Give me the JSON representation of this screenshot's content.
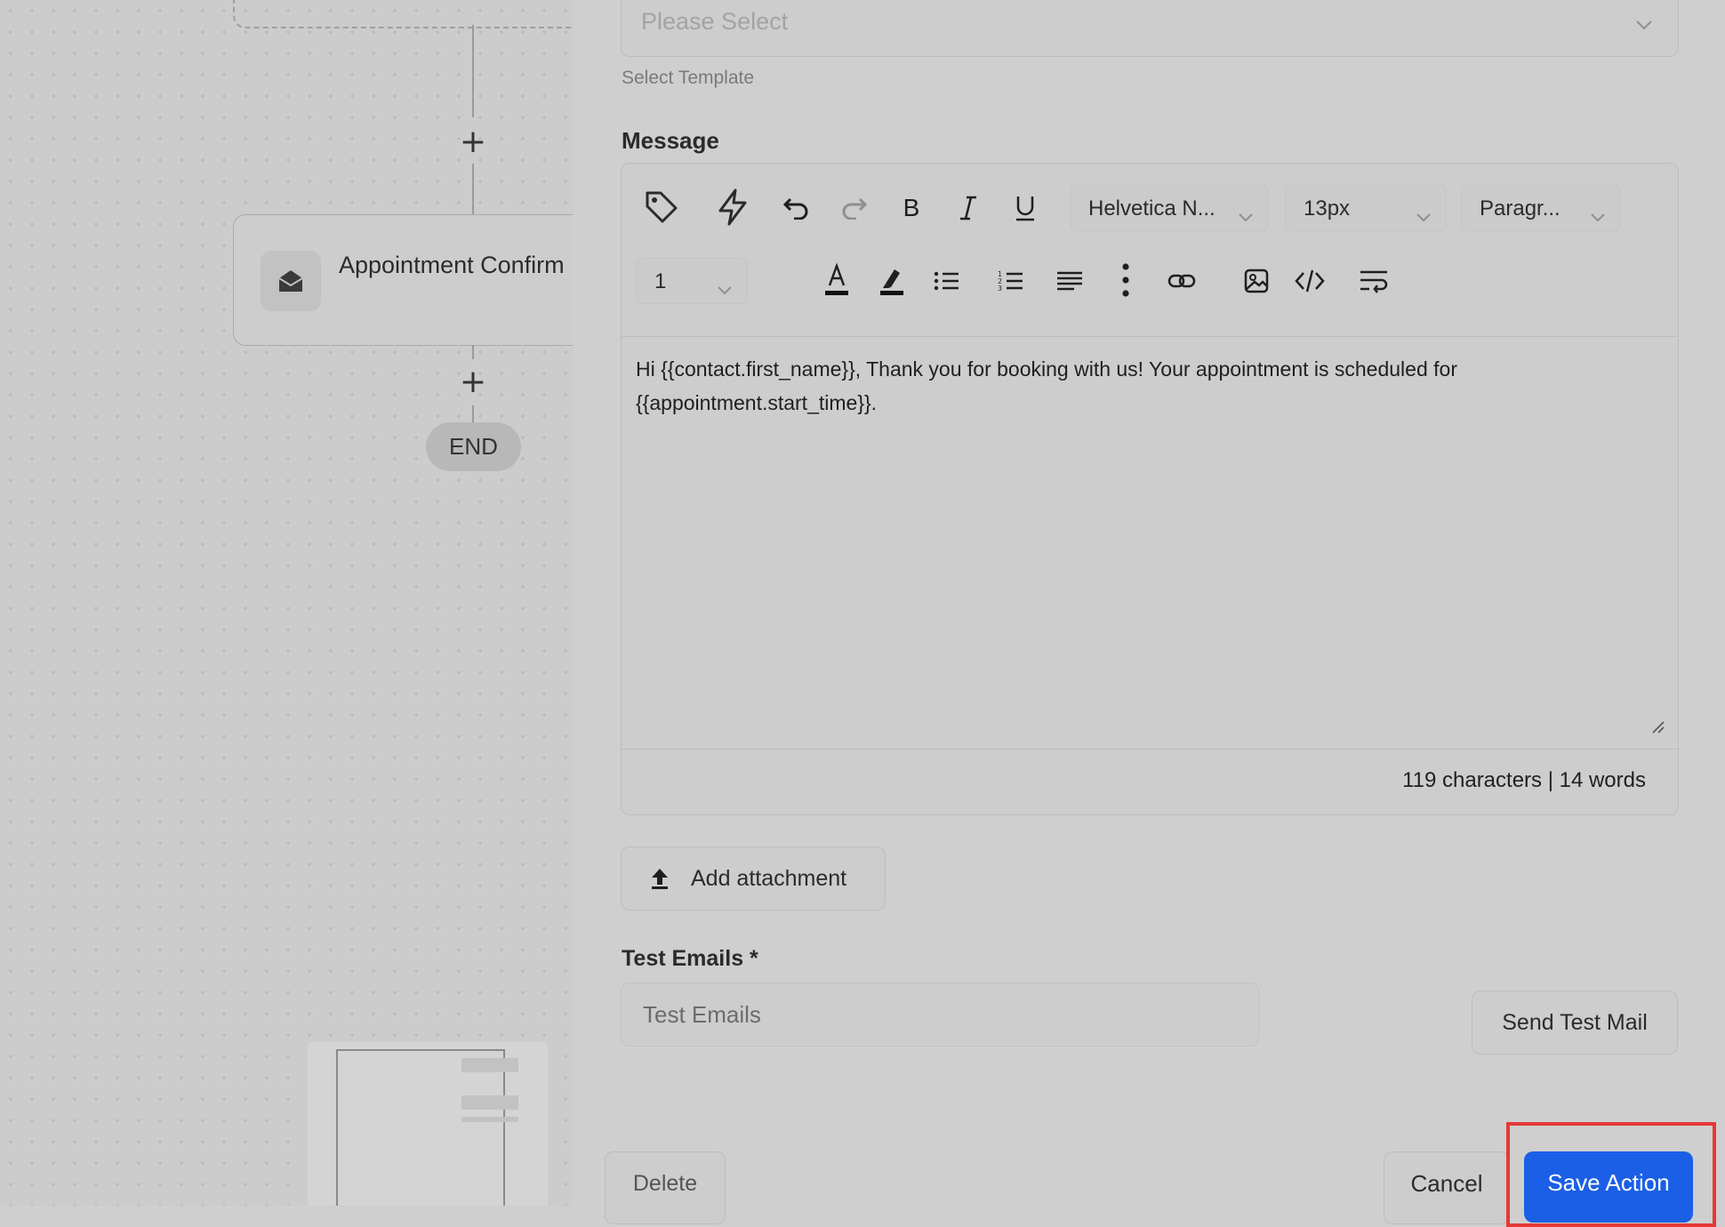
{
  "canvas": {
    "email_node": {
      "title": "Appointment Confirm Email",
      "icon": "envelope-open-icon"
    },
    "add_step_icon": "plus-icon",
    "end_label": "END"
  },
  "form": {
    "template": {
      "placeholder": "Please Select",
      "helper": "Select Template"
    },
    "message_label": "Message",
    "toolbar": {
      "font_family": "Helvetica N...",
      "font_size": "13px",
      "block_format": "Paragr...",
      "line_height": "1",
      "icons": [
        "tag-icon",
        "lightning-icon",
        "undo-icon",
        "redo-icon",
        "bold-icon",
        "italic-icon",
        "underline-icon",
        "text-color-icon",
        "highlight-icon",
        "bullet-list-icon",
        "numbered-list-icon",
        "align-left-icon",
        "more-vertical-icon",
        "link-icon",
        "image-icon",
        "code-icon",
        "wrap-text-icon"
      ]
    },
    "body_text": "Hi {{contact.first_name}}, Thank you for booking with us! Your appointment is scheduled for {{appointment.start_time}}.",
    "counter": "119 characters | 14 words",
    "attach_label": "Add attachment",
    "test_emails": {
      "label": "Test Emails *",
      "placeholder": "Test Emails"
    },
    "send_test_label": "Send Test Mail",
    "delete_label": "Delete",
    "cancel_label": "Cancel",
    "save_label": "Save Action"
  },
  "colors": {
    "primary": "#1b5fe6",
    "highlight": "#e53935",
    "backdrop": "#cccccc"
  }
}
